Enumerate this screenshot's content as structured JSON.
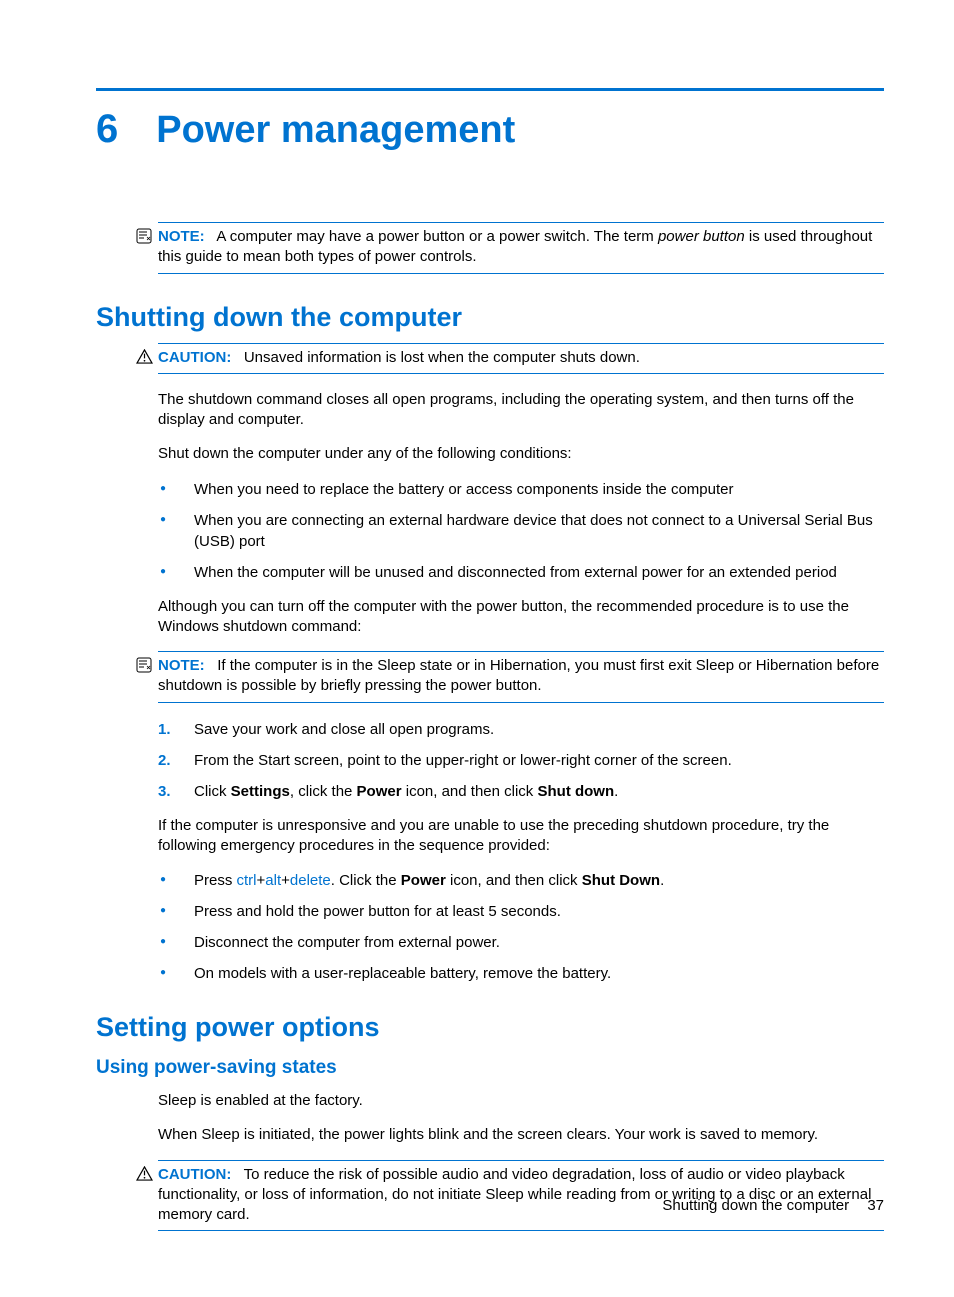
{
  "chapter": {
    "number": "6",
    "title": "Power management"
  },
  "note1": {
    "label": "NOTE:",
    "pre": "A computer may have a power button or a power switch. The term ",
    "italic": "power button",
    "post": " is used throughout this guide to mean both types of power controls."
  },
  "section1": {
    "title": "Shutting down the computer",
    "caution": {
      "label": "CAUTION:",
      "text": "Unsaved information is lost when the computer shuts down."
    },
    "p1": "The shutdown command closes all open programs, including the operating system, and then turns off the display and computer.",
    "p2": "Shut down the computer under any of the following conditions:",
    "bullets1": [
      "When you need to replace the battery or access components inside the computer",
      "When you are connecting an external hardware device that does not connect to a Universal Serial Bus (USB) port",
      "When the computer will be unused and disconnected from external power for an extended period"
    ],
    "p3": "Although you can turn off the computer with the power button, the recommended procedure is to use the Windows shutdown command:",
    "note2": {
      "label": "NOTE:",
      "text": "If the computer is in the Sleep state or in Hibernation, you must first exit Sleep or Hibernation before shutdown is possible by briefly pressing the power button."
    },
    "steps": {
      "s1": "Save your work and close all open programs.",
      "s2": "From the Start screen, point to the upper-right or lower-right corner of the screen.",
      "s3": {
        "pre": "Click ",
        "b1": "Settings",
        "mid1": ", click the ",
        "b2": "Power",
        "mid2": " icon, and then click ",
        "b3": "Shut down",
        "post": "."
      }
    },
    "p4": "If the computer is unresponsive and you are unable to use the preceding shutdown procedure, try the following emergency procedures in the sequence provided:",
    "bullets2": {
      "b1": {
        "pre": "Press ",
        "k1": "ctrl",
        "plus1": "+",
        "k2": "alt",
        "plus2": "+",
        "k3": "delete",
        "mid": ". Click the ",
        "bold1": "Power",
        "mid2": " icon, and then click ",
        "bold2": "Shut Down",
        "post": "."
      },
      "b2": "Press and hold the power button for at least 5 seconds.",
      "b3": "Disconnect the computer from external power.",
      "b4": "On models with a user-replaceable battery, remove the battery."
    }
  },
  "section2": {
    "title": "Setting power options",
    "sub": {
      "title": "Using power-saving states",
      "p1": "Sleep is enabled at the factory.",
      "p2": "When Sleep is initiated, the power lights blink and the screen clears. Your work is saved to memory.",
      "caution": {
        "label": "CAUTION:",
        "text": "To reduce the risk of possible audio and video degradation, loss of audio or video playback functionality, or loss of information, do not initiate Sleep while reading from or writing to a disc or an external memory card."
      }
    }
  },
  "footer": {
    "text": "Shutting down the computer",
    "page": "37"
  }
}
